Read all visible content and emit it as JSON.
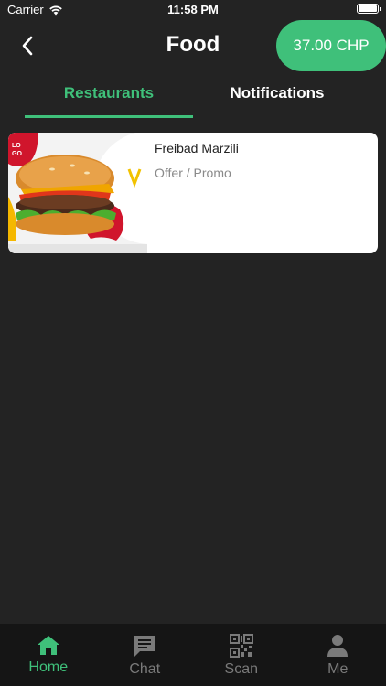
{
  "status_bar": {
    "carrier": "Carrier",
    "time": "11:58 PM"
  },
  "header": {
    "title": "Food",
    "balance": "37.00 CHP"
  },
  "tabs": [
    {
      "label": "Restaurants",
      "active": true
    },
    {
      "label": "Notifications",
      "active": false
    }
  ],
  "restaurants": [
    {
      "name": "Freibad Marzili",
      "subtitle": "Offer / Promo",
      "logo_text": "LOGO"
    }
  ],
  "tab_bar": {
    "items": [
      {
        "label": "Home",
        "icon": "home-icon",
        "active": true
      },
      {
        "label": "Chat",
        "icon": "chat-icon",
        "active": false
      },
      {
        "label": "Scan",
        "icon": "qr-code-icon",
        "active": false
      },
      {
        "label": "Me",
        "icon": "person-icon",
        "active": false
      }
    ]
  },
  "colors": {
    "accent": "#3fc07a",
    "background": "#232323",
    "tab_bar": "#151515",
    "card": "#ffffff"
  }
}
